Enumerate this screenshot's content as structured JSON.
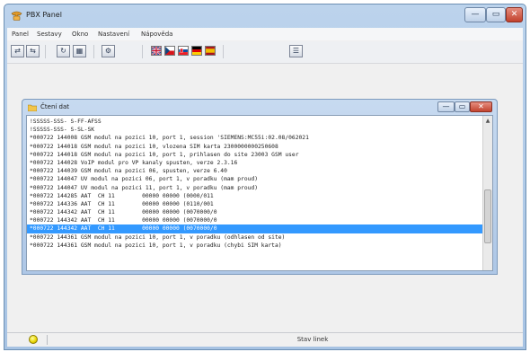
{
  "window": {
    "title": "PBX Panel",
    "minimize_glyph": "—",
    "maximize_glyph": "▭",
    "close_glyph": "✕",
    "app_icon": "pbx-phone-icon"
  },
  "menu": [
    "Panel",
    "Sestavy",
    "Okno",
    "Nastavení",
    "Nápověda"
  ],
  "toolbar": {
    "buttons": [
      {
        "icon": "connect-icon",
        "glyph": "⇄"
      },
      {
        "icon": "disconnect-icon",
        "glyph": "⇆"
      },
      {
        "icon": "refresh-icon",
        "glyph": "↻"
      },
      {
        "icon": "grid-icon",
        "glyph": "▦"
      },
      {
        "icon": "settings-icon",
        "glyph": "⚙"
      },
      {
        "icon": "users-icon",
        "glyph": "☰"
      }
    ],
    "flags": [
      "gb-flag-icon",
      "cz-flag-icon",
      "sk-flag-icon",
      "de-flag-icon",
      "es-flag-icon"
    ]
  },
  "child_window": {
    "title": "Čtení dat",
    "icon": "folder-icon",
    "minimize_glyph": "—",
    "maximize_glyph": "▭",
    "close_glyph": "✕"
  },
  "log": {
    "selected_index": 13,
    "lines": [
      "!SSSSS-SSS- S-FF-AFSS",
      "!SSSSS-SSS- S-SL-SK",
      "*000722 144008 GSM modul na pozici 10, port 1, session 'SIEMENS:MC55i:02.08/062021",
      "*000722 144018 GSM modul na pozici 10, vlozena SIM karta 2300000000250608",
      "*000722 144018 GSM modul na pozici 10, port 1, prihlasen do site 23003 GSM user",
      "*000722 144028 VoIP modul pro VP kanaly spusten, verze 2.3.16",
      "*000722 144039 GSM modul na pozici 06, spusten, verze 6.40",
      "*000722 144047 UV modul na pozici 06, port 1, v poradku (mam proud)",
      "*000722 144047 UV modul na pozici 11, port 1, v poradku (mam proud)",
      "*000722 144285 AAT  CH 11        00000 00000 (0000/011",
      "*000722 144336 AAT  CH 11        00000 00000 (0110/001",
      "*000722 144342 AAT  CH 11        00000 00000 (0070000/0",
      "*000722 144342 AAT  CH 11        00000 00000 (0070000/0",
      "*000722 144342 AAT  CH 11        00000 00000 (0070000/0",
      "*000722 144361 GSM modul na pozici 10, port 1, v poradku (odhlasen od site)",
      "*000722 144361 GSM modul na pozici 10, port 1, v poradku (chybi SIM karta)"
    ]
  },
  "status": {
    "indicator_icon": "lightbulb-icon",
    "text": "Stav linek"
  },
  "colors": {
    "selection": "#3399ff",
    "title_gradient_top": "#bcd3ec",
    "close_button": "#c2412c"
  }
}
